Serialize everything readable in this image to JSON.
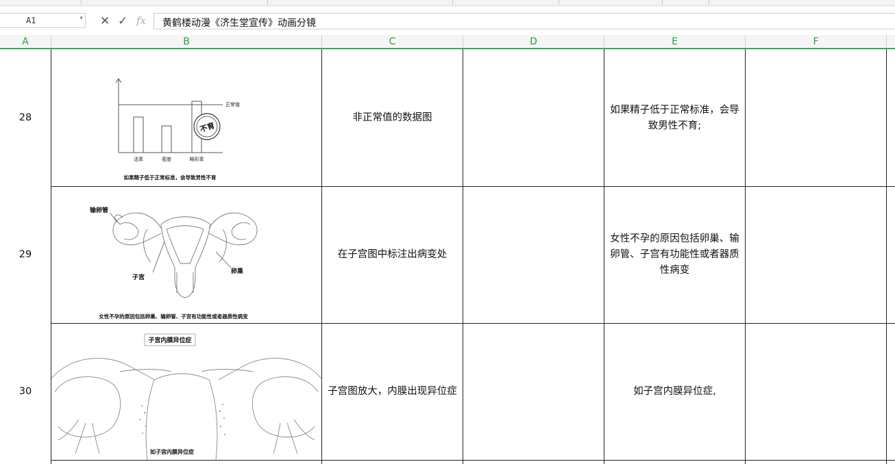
{
  "formula_bar": {
    "name_box": "A1",
    "formula": "黄鹤楼动漫《济生堂宣传》动画分镜",
    "cancel_icon": "close-x-icon",
    "confirm_icon": "checkmark-icon",
    "function_icon": "fx"
  },
  "columns": [
    "A",
    "B",
    "C",
    "D",
    "E",
    "F"
  ],
  "rows": [
    {
      "number": "28",
      "image": {
        "caption": "如果精子低于正常标准，会导致男性不育",
        "label_normal": "正常值",
        "stamp": "不育",
        "bar_labels": [
          "活率",
          "密度",
          "畸形率"
        ]
      },
      "description": "非正常值的数据图",
      "d": "",
      "narration": "如果精子低于正常标准，会导致男性不育;",
      "f": ""
    },
    {
      "number": "29",
      "image": {
        "caption": "女性不孕的原因包括卵巢、输卵管、子宫有功能性或者器质性病变",
        "label_tube": "输卵管",
        "label_uterus": "子宫",
        "label_ovary": "卵巢"
      },
      "description": "在子宫图中标注出病变处",
      "d": "",
      "narration": "女性不孕的原因包括卵巢、输卵管、子宫有功能性或者器质性病变",
      "f": ""
    },
    {
      "number": "30",
      "image": {
        "title": "子宫内膜异位症",
        "caption": "如子宫内膜异位症"
      },
      "description": "子宫图放大，内膜出现异位症",
      "d": "",
      "narration": "如子宫内膜异位症,",
      "f": ""
    }
  ]
}
